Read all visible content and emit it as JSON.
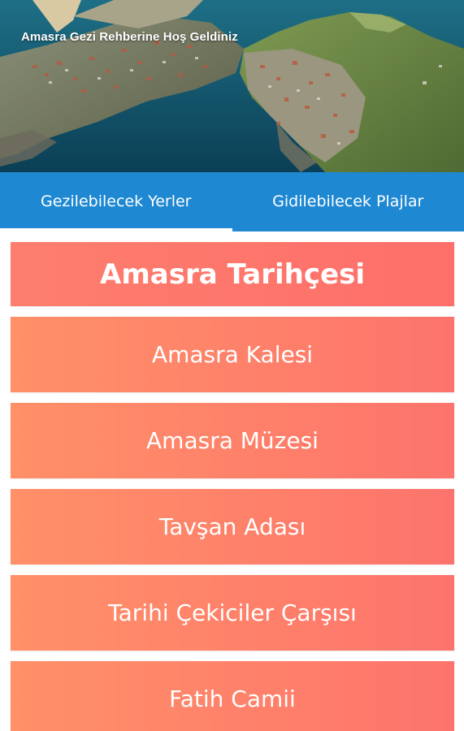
{
  "header": {
    "title": "Amasra Gezi Rehberine Hoş Geldiniz"
  },
  "tabs": [
    {
      "label": "Gezilebilecek Yerler",
      "active": true
    },
    {
      "label": "Gidilebilecek Plajlar",
      "active": false
    }
  ],
  "list": {
    "heading": "Amasra Tarihçesi",
    "items": [
      {
        "label": "Amasra Kalesi"
      },
      {
        "label": "Amasra Müzesi"
      },
      {
        "label": "Tavşan Adası"
      },
      {
        "label": "Tarihi Çekiciler Çarşısı"
      },
      {
        "label": "Fatih Camii"
      }
    ]
  },
  "colors": {
    "tab_bar": "#1e88d2",
    "card_gradient_start": "#ff9068",
    "card_gradient_end": "#fd746c",
    "heading_card": "#fd7a6d"
  }
}
